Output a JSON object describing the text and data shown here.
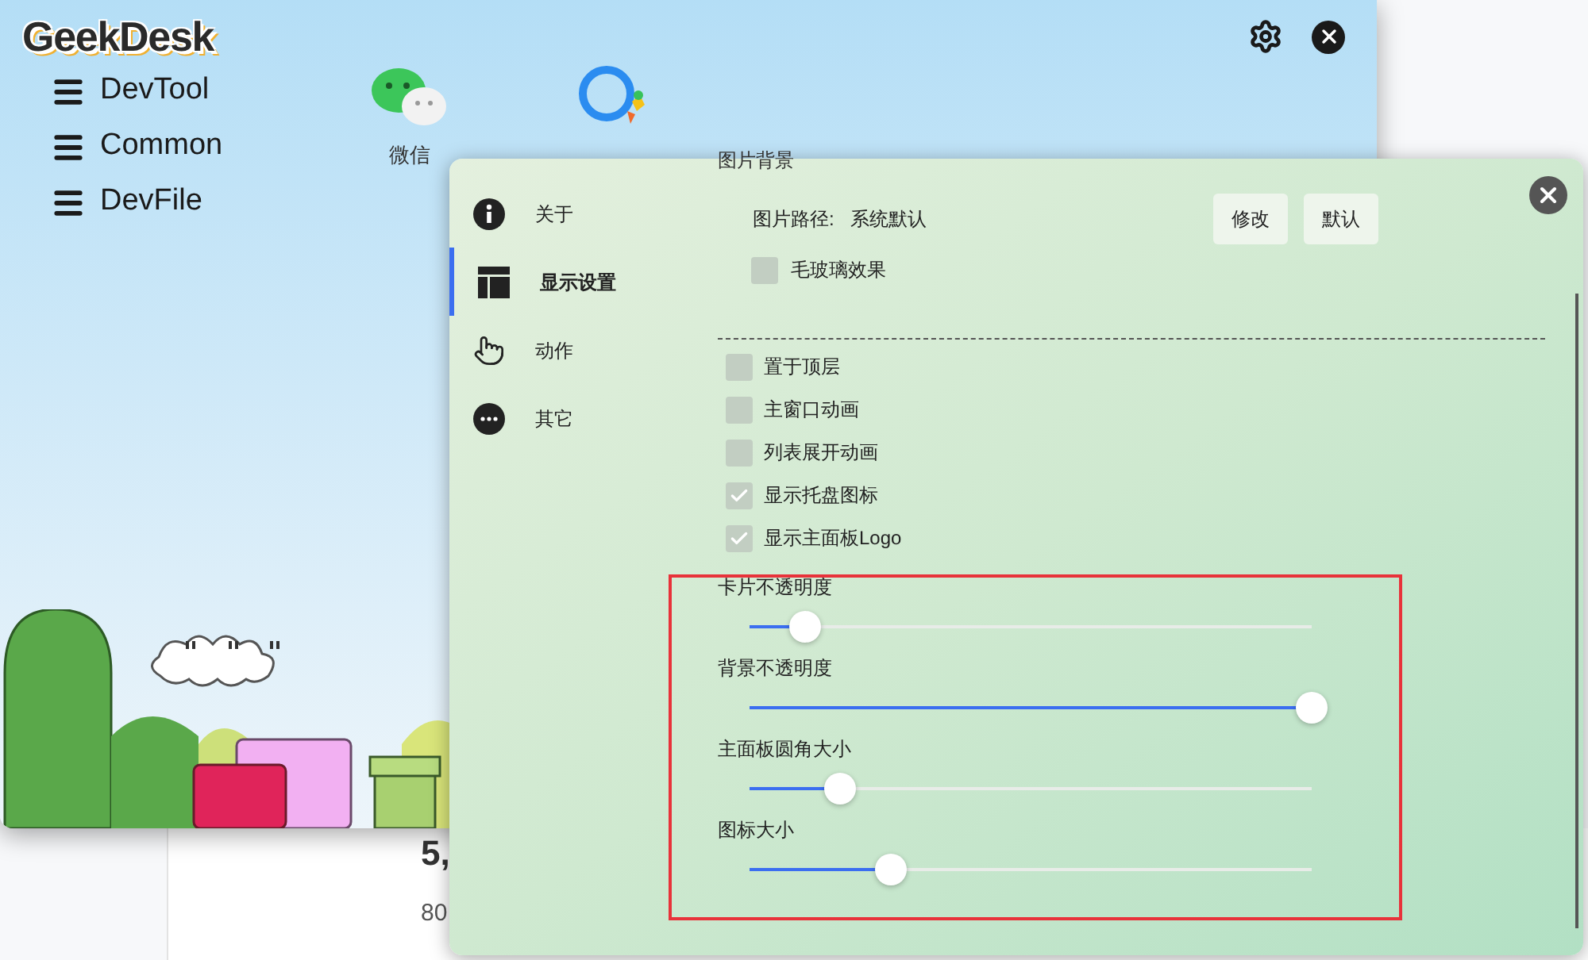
{
  "main_window": {
    "logo": "GeekDesk",
    "menu": [
      {
        "label": "DevTool"
      },
      {
        "label": "Common"
      },
      {
        "label": "DevFile"
      }
    ],
    "apps": [
      {
        "kind": "wechat",
        "label": "微信"
      },
      {
        "kind": "chat"
      }
    ]
  },
  "behind": {
    "texts": [
      "5,",
      "80"
    ]
  },
  "settings": {
    "nav": [
      {
        "kind": "info",
        "label": "关于",
        "selected": false
      },
      {
        "kind": "layout",
        "label": "显示设置",
        "selected": true
      },
      {
        "kind": "hand",
        "label": "动作",
        "selected": false
      },
      {
        "kind": "more",
        "label": "其它",
        "selected": false
      }
    ],
    "section_title": "图片背景",
    "path_label": "图片路径:",
    "path_value": "系统默认",
    "buttons": [
      "修改",
      "默认"
    ],
    "blur": {
      "label": "毛玻璃效果",
      "checked": false
    },
    "options": [
      {
        "label": "置于顶层",
        "checked": false
      },
      {
        "label": "主窗口动画",
        "checked": false
      },
      {
        "label": "列表展开动画",
        "checked": false
      },
      {
        "label": "显示托盘图标",
        "checked": true
      },
      {
        "label": "显示主面板Logo",
        "checked": true
      }
    ],
    "sliders": [
      {
        "label": "卡片不透明度",
        "level": 0.1
      },
      {
        "label": "背景不透明度",
        "level": 1
      },
      {
        "label": "主面板圆角大小",
        "level": 0.16
      },
      {
        "label": "图标大小",
        "level": 0.25
      }
    ]
  }
}
